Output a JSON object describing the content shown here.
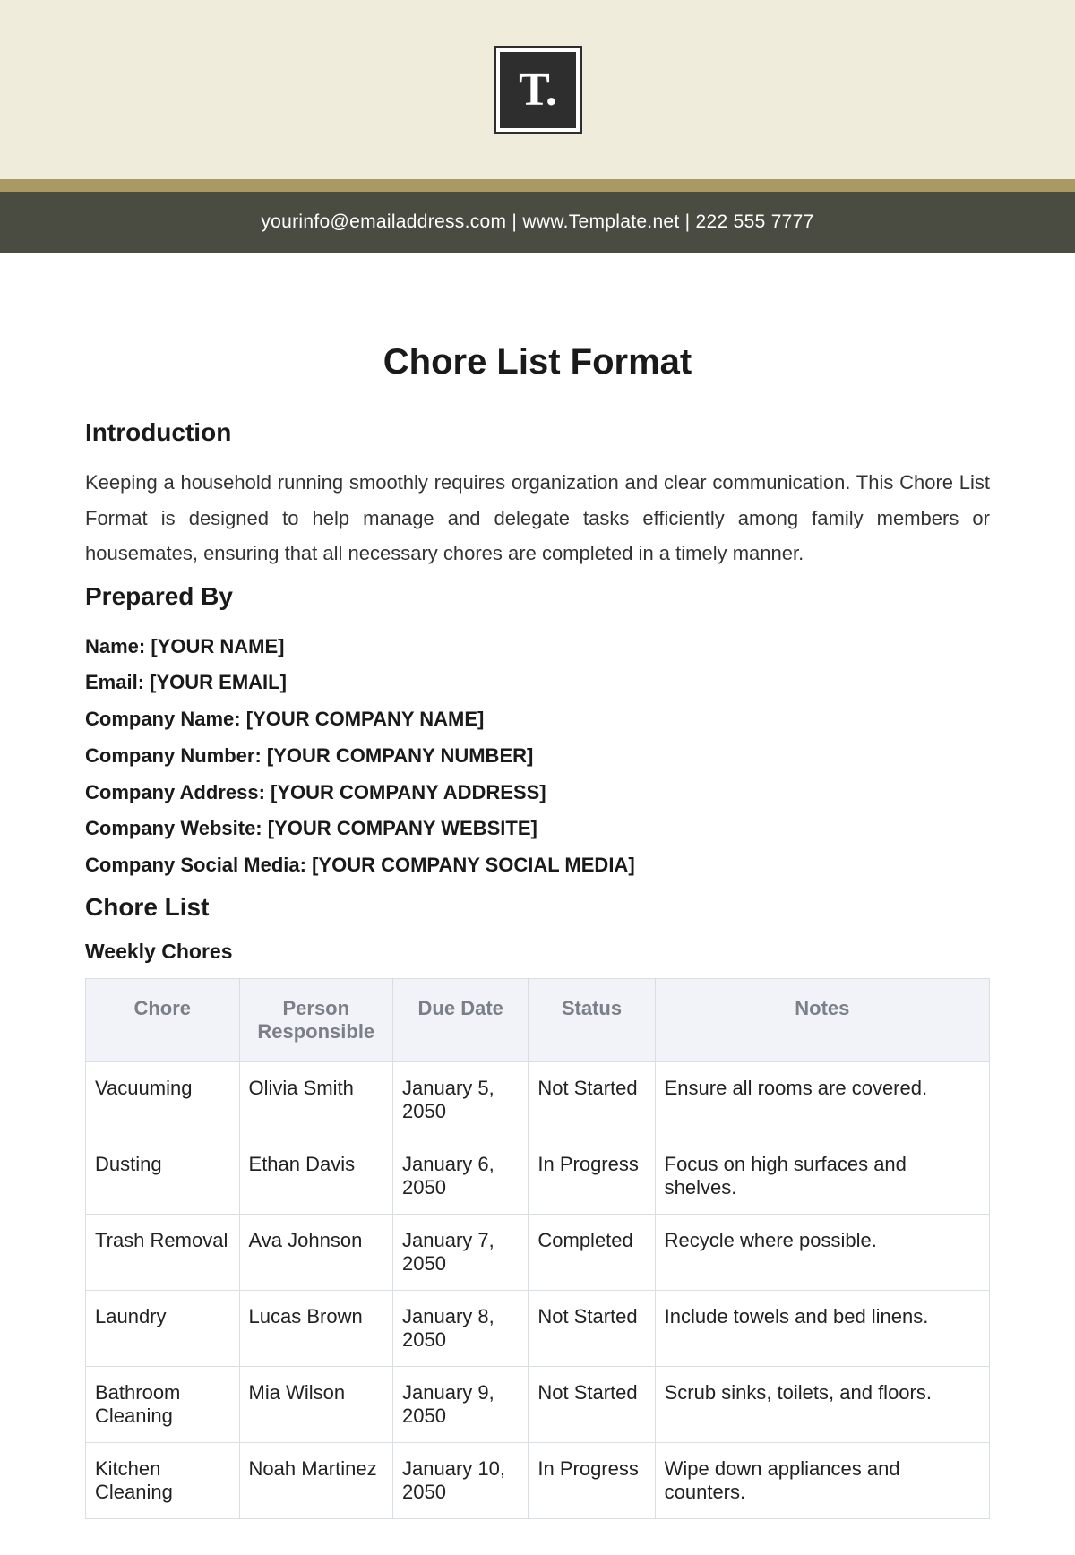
{
  "header": {
    "logo_text": "T.",
    "contact_line": "yourinfo@emailaddress.com  |  www.Template.net  |  222 555 7777"
  },
  "title": "Chore List Format",
  "introduction": {
    "heading": "Introduction",
    "text": "Keeping a household running smoothly requires organization and clear communication. This Chore List Format is designed to help manage and delegate tasks efficiently among family members or housemates, ensuring that all necessary chores are completed in a timely manner."
  },
  "prepared_by": {
    "heading": "Prepared By",
    "fields": [
      {
        "label": "Name:",
        "value": "[YOUR NAME]"
      },
      {
        "label": "Email:",
        "value": "[YOUR EMAIL]"
      },
      {
        "label": "Company Name:",
        "value": "[YOUR COMPANY NAME]"
      },
      {
        "label": "Company Number:",
        "value": "[YOUR COMPANY NUMBER]"
      },
      {
        "label": "Company Address:",
        "value": "[YOUR COMPANY ADDRESS]"
      },
      {
        "label": "Company Website:",
        "value": "[YOUR COMPANY WEBSITE]"
      },
      {
        "label": "Company Social Media:",
        "value": "[YOUR COMPANY SOCIAL MEDIA]"
      }
    ]
  },
  "chore_list": {
    "heading": "Chore List",
    "subheading": "Weekly Chores",
    "columns": [
      "Chore",
      "Person Responsible",
      "Due Date",
      "Status",
      "Notes"
    ],
    "rows": [
      {
        "chore": "Vacuuming",
        "person": "Olivia Smith",
        "due": "January 5, 2050",
        "status": "Not Started",
        "notes": "Ensure all rooms are covered."
      },
      {
        "chore": "Dusting",
        "person": "Ethan Davis",
        "due": "January 6, 2050",
        "status": "In Progress",
        "notes": "Focus on high surfaces and shelves."
      },
      {
        "chore": "Trash Removal",
        "person": "Ava Johnson",
        "due": "January 7, 2050",
        "status": "Completed",
        "notes": "Recycle where possible."
      },
      {
        "chore": "Laundry",
        "person": "Lucas Brown",
        "due": "January 8, 2050",
        "status": "Not Started",
        "notes": "Include towels and bed linens."
      },
      {
        "chore": "Bathroom Cleaning",
        "person": "Mia Wilson",
        "due": "January 9, 2050",
        "status": "Not Started",
        "notes": "Scrub sinks, toilets, and floors."
      },
      {
        "chore": "Kitchen Cleaning",
        "person": "Noah Martinez",
        "due": "January 10, 2050",
        "status": "In Progress",
        "notes": "Wipe down appliances and counters."
      }
    ]
  }
}
